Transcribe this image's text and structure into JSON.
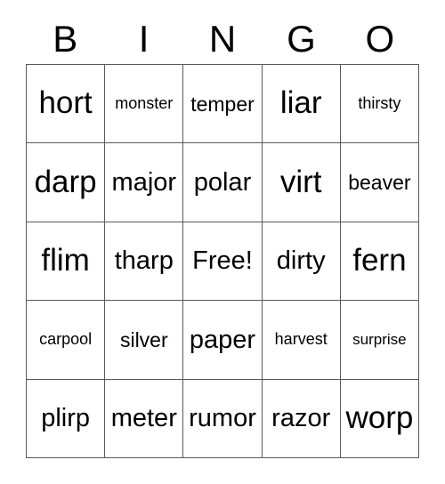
{
  "card": {
    "title": "BINGO",
    "header_letters": [
      "B",
      "I",
      "N",
      "G",
      "O"
    ],
    "rows": 5,
    "columns": 5,
    "free_space_label": "Free!",
    "free_space_position": {
      "row": 3,
      "column": 3
    },
    "colors": {
      "background": "#ffffff",
      "cell_background": "#ffffff",
      "border": "#5a5a5a",
      "text": "#000000"
    },
    "grid": [
      [
        "hort",
        "monster",
        "temper",
        "liar",
        "thirsty"
      ],
      [
        "darp",
        "major",
        "polar",
        "virt",
        "beaver"
      ],
      [
        "flim",
        "tharp",
        "Free!",
        "dirty",
        "fern"
      ],
      [
        "carpool",
        "silver",
        "paper",
        "harvest",
        "surprise"
      ],
      [
        "plirp",
        "meter",
        "rumor",
        "razor",
        "worp"
      ]
    ]
  }
}
